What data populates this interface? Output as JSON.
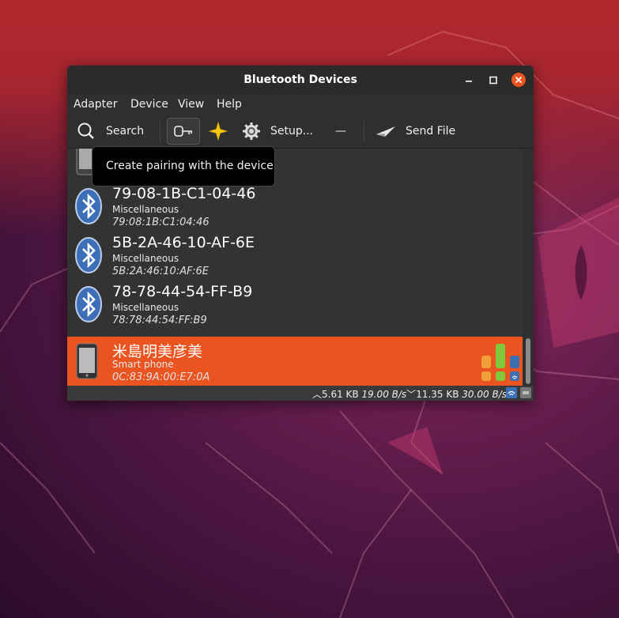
{
  "window": {
    "title": "Bluetooth Devices",
    "min_icon": "minimize-icon",
    "max_icon": "maximize-icon",
    "close_icon": "close-icon",
    "accent": "#e95420"
  },
  "menubar": {
    "items": [
      "Adapter",
      "Device",
      "View",
      "Help"
    ]
  },
  "toolbar": {
    "search_label": "Search",
    "setup_label": "Setup...",
    "remove_label": "—",
    "send_file_label": "Send File",
    "icons": [
      "search-icon",
      "key-icon",
      "star-icon",
      "gear-icon",
      "paper-plane-icon"
    ]
  },
  "tooltip": {
    "text": "Create pairing with the device"
  },
  "devices": [
    {
      "name": "79-08-1B-C1-04-46",
      "class": "Miscellaneous",
      "mac": "79:08:1B:C1:04:46",
      "icon": "bluetooth-icon"
    },
    {
      "name": "5B-2A-46-10-AF-6E",
      "class": "Miscellaneous",
      "mac": "5B:2A:46:10:AF:6E",
      "icon": "bluetooth-icon"
    },
    {
      "name": "78-78-44-54-FF-B9",
      "class": "Miscellaneous",
      "mac": "78:78:44:54:FF:B9",
      "icon": "bluetooth-icon"
    },
    {
      "name": "米島明美彦美",
      "class": "Smart phone",
      "mac": "0C:83:9A:00:E7:0A",
      "icon": "phone-icon",
      "selected": true
    }
  ],
  "status": {
    "upload": "5.61 KB",
    "upload_rate": "19.00 B/s",
    "download": "11.35 KB",
    "download_rate": "30.00 B/s"
  }
}
